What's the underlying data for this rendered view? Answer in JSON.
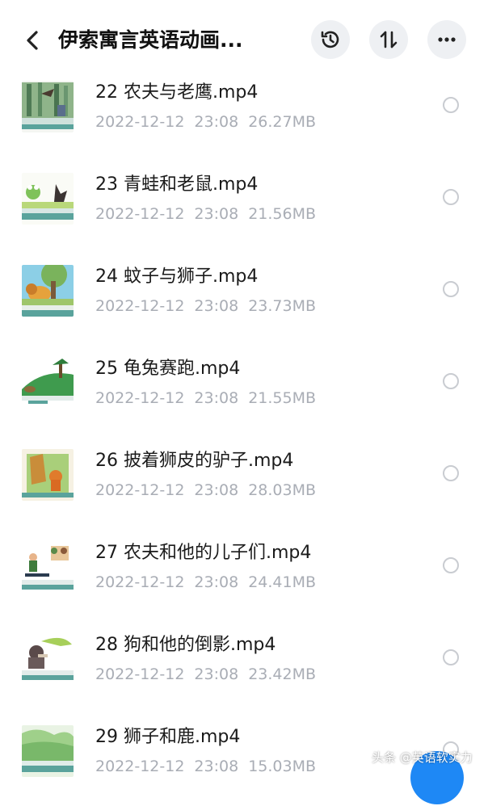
{
  "header": {
    "title": "伊索寓言英语动画...",
    "back_icon": "chevron-left-icon",
    "history_icon": "history-icon",
    "sort_icon": "sort-icon",
    "more_icon": "more-horizontal-icon"
  },
  "files": [
    {
      "name": "22 农夫与老鹰.mp4",
      "date": "2022-12-12",
      "time": "23:08",
      "size": "26.27MB"
    },
    {
      "name": "23 青蛙和老鼠.mp4",
      "date": "2022-12-12",
      "time": "23:08",
      "size": "21.56MB"
    },
    {
      "name": "24 蚊子与狮子.mp4",
      "date": "2022-12-12",
      "time": "23:08",
      "size": "23.73MB"
    },
    {
      "name": "25 龟兔赛跑.mp4",
      "date": "2022-12-12",
      "time": "23:08",
      "size": "21.55MB"
    },
    {
      "name": "26 披着狮皮的驴子.mp4",
      "date": "2022-12-12",
      "time": "23:08",
      "size": "28.03MB"
    },
    {
      "name": "27 农夫和他的儿子们.mp4",
      "date": "2022-12-12",
      "time": "23:08",
      "size": "24.41MB"
    },
    {
      "name": "28 狗和他的倒影.mp4",
      "date": "2022-12-12",
      "time": "23:08",
      "size": "23.42MB"
    },
    {
      "name": "29 狮子和鹿.mp4",
      "date": "2022-12-12",
      "time": "23:08",
      "size": "15.03MB"
    }
  ],
  "watermark": "头条 @英语软实力",
  "colors": {
    "accent": "#1e88f5",
    "meta_text": "#a9adb5",
    "button_bg": "#eef0f3"
  }
}
